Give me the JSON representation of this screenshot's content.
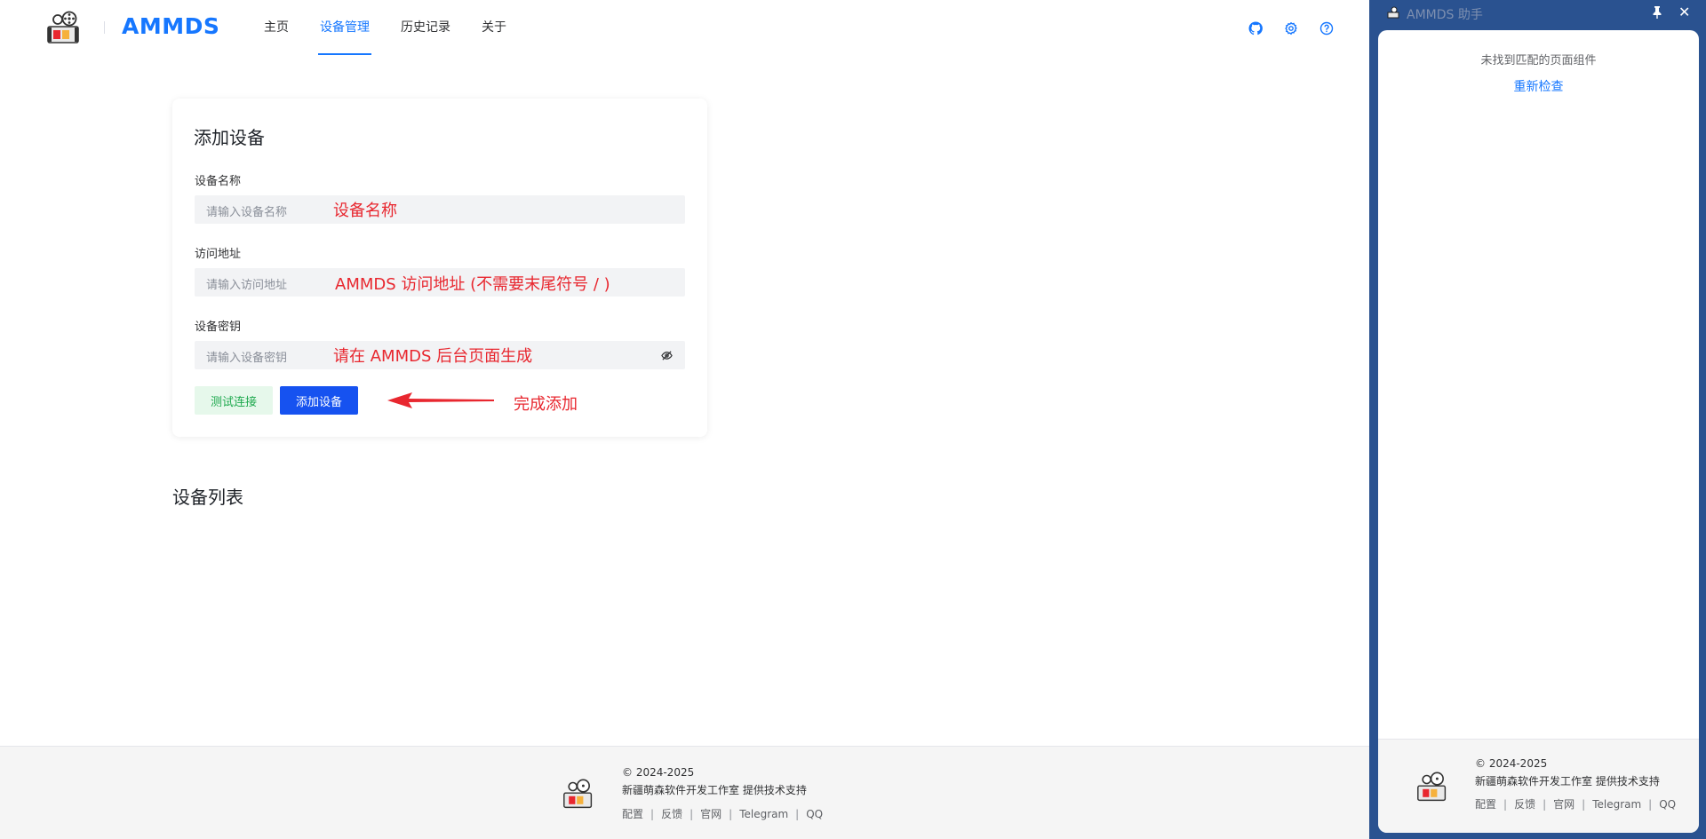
{
  "header": {
    "brand": "AMMDS",
    "nav": [
      "主页",
      "设备管理",
      "历史记录",
      "关于"
    ],
    "active_nav": "设备管理",
    "icons": [
      "github-icon",
      "settings-icon",
      "help-icon"
    ]
  },
  "form": {
    "title": "添加设备",
    "fields": [
      {
        "label": "设备名称",
        "placeholder": "请输入设备名称",
        "annotation": "设备名称"
      },
      {
        "label": "访问地址",
        "placeholder": "请输入访问地址",
        "annotation": "AMMDS 访问地址 (不需要末尾符号 / )"
      },
      {
        "label": "设备密钥",
        "placeholder": "请输入设备密钥",
        "annotation": "请在 AMMDS 后台页面生成"
      }
    ],
    "test_button": "测试连接",
    "add_button": "添加设备",
    "arrow_annotation": "完成添加"
  },
  "device_list": {
    "title": "设备列表"
  },
  "footer": {
    "copyright": "© 2024-2025",
    "support": "新疆萌森软件开发工作室 提供技术支持",
    "links": [
      "配置",
      "反馈",
      "官网",
      "Telegram",
      "QQ"
    ]
  },
  "panel": {
    "title": "AMMDS 助手",
    "message": "未找到匹配的页面组件",
    "recheck": "重新检查"
  },
  "colors": {
    "accent": "#1677ff",
    "primary_button": "#1652f0",
    "success_text": "#1ea94e",
    "annotation": "#e8272f",
    "panel_bg": "#2a5290"
  }
}
